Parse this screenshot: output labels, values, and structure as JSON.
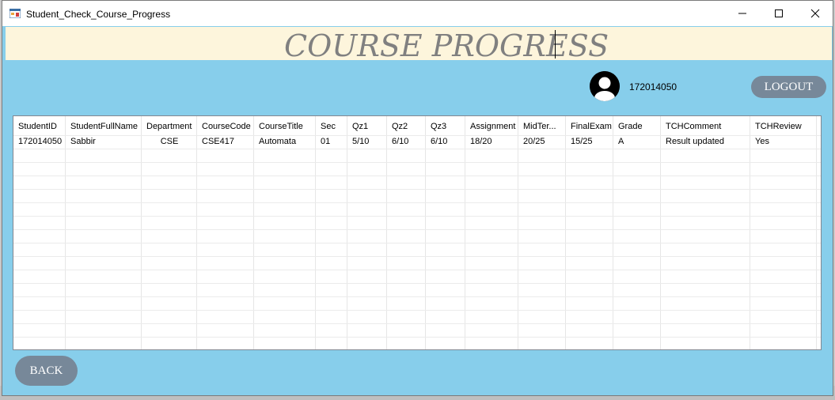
{
  "window": {
    "title": "Student_Check_Course_Progress"
  },
  "header": {
    "title": "COURSE PROGRESS"
  },
  "user": {
    "id": "172014050"
  },
  "buttons": {
    "logout": "LOGOUT",
    "back": "BACK"
  },
  "grid": {
    "columns": [
      "StudentID",
      "StudentFullName",
      "Department",
      "CourseCode",
      "CourseTitle",
      "Sec",
      "Qz1",
      "Qz2",
      "Qz3",
      "Assignment",
      "MidTer...",
      "FinalExam",
      "Grade",
      "TCHComment",
      "TCHReview"
    ],
    "rows": [
      [
        "172014050",
        "Sabbir",
        "CSE",
        "CSE417",
        "Automata",
        "01",
        "5/10",
        "6/10",
        "6/10",
        "18/20",
        "20/25",
        "15/25",
        "A",
        "Result updated",
        "Yes"
      ]
    ]
  },
  "colors": {
    "form_background": "#87ceeb",
    "header_band": "#fdf5dc",
    "button": "#778899"
  },
  "icons": {
    "app": "app-form-icon",
    "user": "user-avatar-icon"
  }
}
